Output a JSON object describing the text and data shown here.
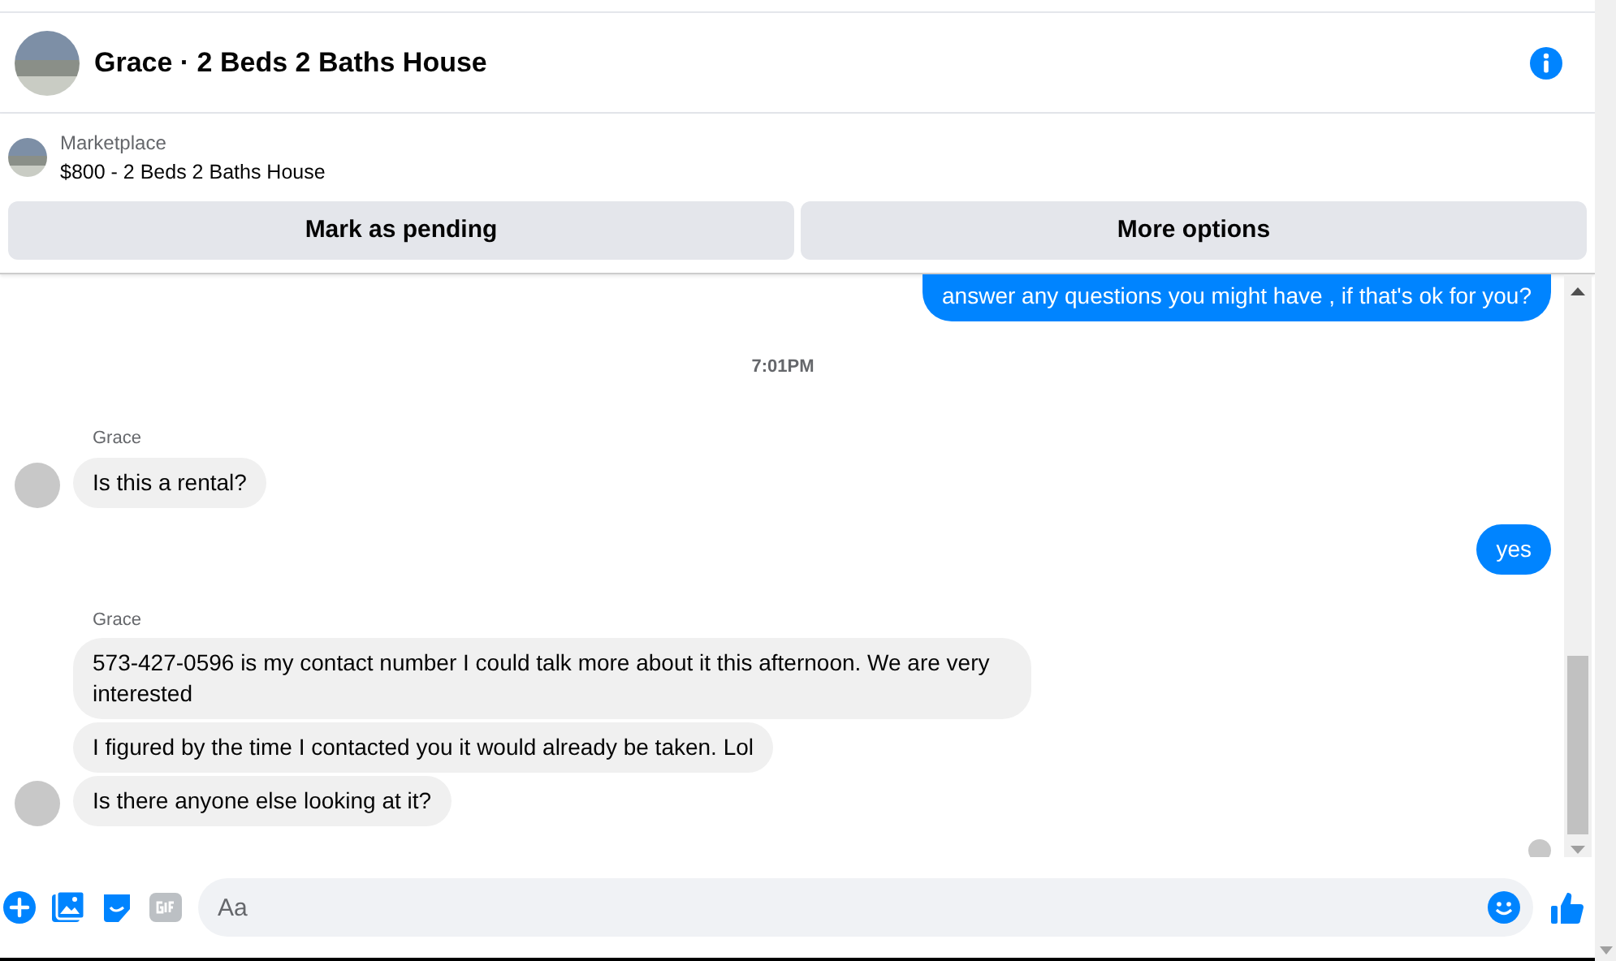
{
  "header": {
    "title": "Grace · 2 Beds 2 Baths House"
  },
  "listing": {
    "source": "Marketplace",
    "title": "$800 - 2 Beds 2 Baths House"
  },
  "actions": [
    "Mark as pending",
    "More options"
  ],
  "messages": [
    {
      "kind": "outgoing",
      "text": "answer any questions you might have , if that's ok for you?",
      "cut_top": true
    },
    {
      "kind": "time",
      "text": "7:01PM"
    },
    {
      "kind": "sender",
      "text": "Grace"
    },
    {
      "kind": "incoming",
      "text": "Is this a rental?",
      "avatar": true
    },
    {
      "kind": "outgoing",
      "text": "yes",
      "cut_top": false
    },
    {
      "kind": "sender",
      "text": "Grace"
    },
    {
      "kind": "incoming",
      "text": "573-427-0596 is my contact number I could talk more about it this afternoon. We are very interested",
      "avatar": false
    },
    {
      "kind": "incoming",
      "text": "I figured by the time I contacted you it would already be taken. Lol",
      "avatar": false
    },
    {
      "kind": "incoming",
      "text": "Is there anyone else looking at it?",
      "avatar": true
    }
  ],
  "composer": {
    "placeholder": "Aa"
  }
}
